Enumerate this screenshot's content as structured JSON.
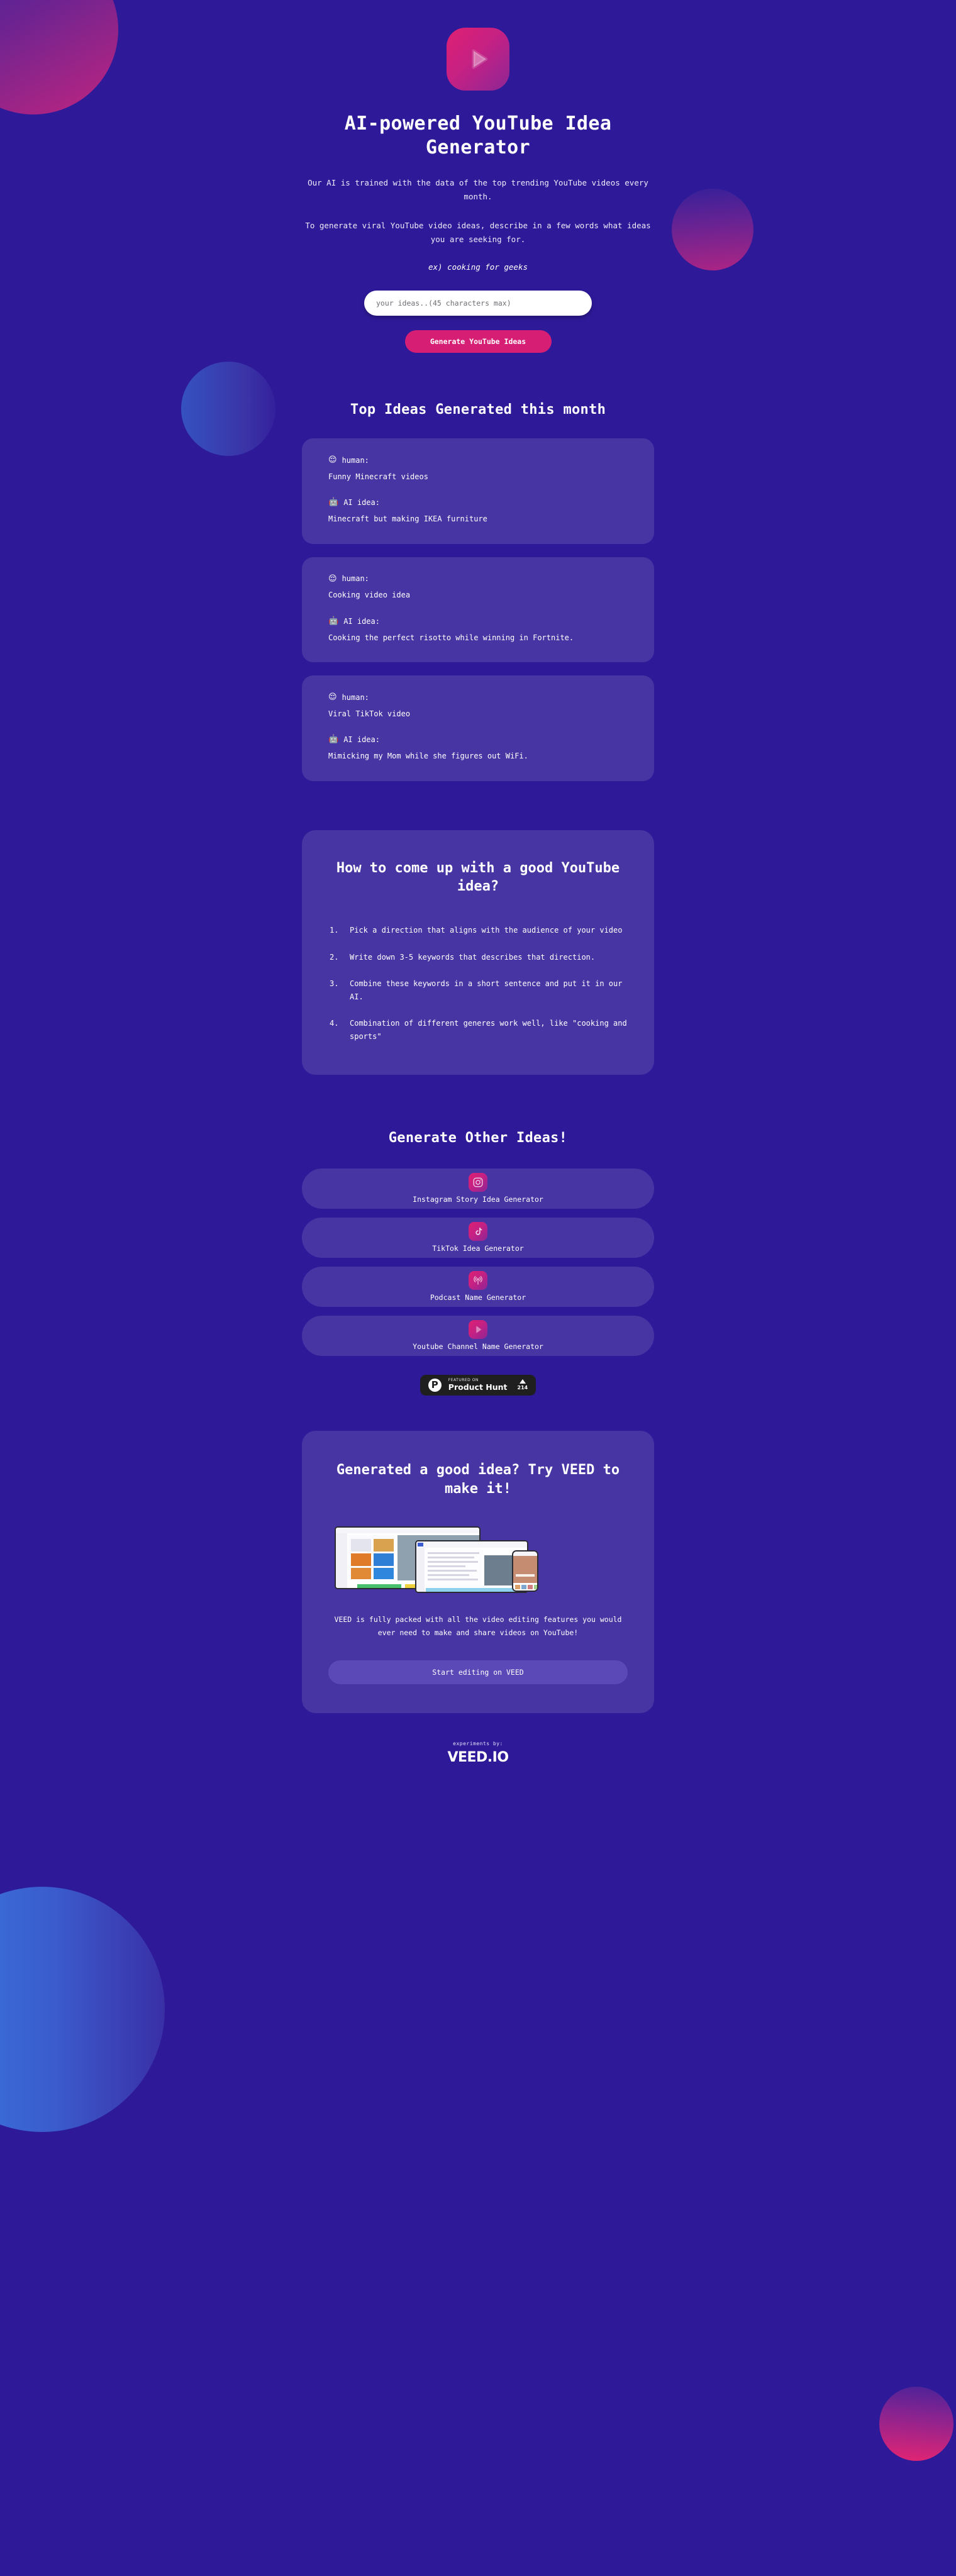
{
  "hero": {
    "logo_icon": "play-logo-icon",
    "title": "AI-powered YouTube Idea Generator",
    "subtitle_1": "Our AI is trained with the data of the top trending YouTube videos every month.",
    "subtitle_2": "To generate viral YouTube video ideas, describe in a few words what ideas you are seeking for.",
    "example": "ex) cooking for geeks"
  },
  "form": {
    "input_placeholder": "your ideas..(45 characters max)",
    "input_value": "",
    "submit_label": "Generate YouTube Ideas"
  },
  "top_ideas": {
    "heading": "Top Ideas Generated this month",
    "human_label": "human:",
    "ai_label": "AI idea:",
    "human_emoji": "😌",
    "ai_emoji": "🤖",
    "items": [
      {
        "human": "Funny Minecraft videos",
        "ai": "Minecraft but making IKEA furniture"
      },
      {
        "human": "Cooking video idea",
        "ai": "Cooking the perfect risotto while winning in Fortnite."
      },
      {
        "human": "Viral TikTok video",
        "ai": "Mimicking my Mom while she figures out WiFi."
      }
    ]
  },
  "howto": {
    "heading": "How to come up with a good YouTube idea?",
    "steps": [
      "Pick a direction that aligns with the audience of your video",
      "Write down 3-5 keywords that describes that direction.",
      "Combine these keywords in a short sentence and put it in our AI.",
      "Combination of different generes work well, like \"cooking and sports\""
    ]
  },
  "other_generators": {
    "heading": "Generate Other Ideas!",
    "items": [
      {
        "icon": "instagram-icon",
        "label": "Instagram Story Idea Generator"
      },
      {
        "icon": "tiktok-icon",
        "label": "TikTok Idea Generator"
      },
      {
        "icon": "podcast-icon",
        "label": "Podcast Name Generator"
      },
      {
        "icon": "youtube-play-icon",
        "label": "Youtube Channel Name Generator"
      }
    ]
  },
  "product_hunt": {
    "featured_label": "FEATURED ON",
    "name": "Product Hunt",
    "upvotes": "214",
    "logo_letter": "P"
  },
  "promo": {
    "heading": "Generated a good idea? Try VEED to make it!",
    "description": "VEED is fully packed with all the video editing features you would ever need to make and share videos on YouTube!",
    "cta_label": "Start editing on VEED"
  },
  "footer": {
    "by_label": "experiments by:",
    "brand": "VEED.IO"
  },
  "colors": {
    "background": "#2e1a99",
    "card": "#4835a4",
    "accent_pink": "#d61f74",
    "button_purple": "#5c49b8",
    "text": "#ffffff"
  }
}
